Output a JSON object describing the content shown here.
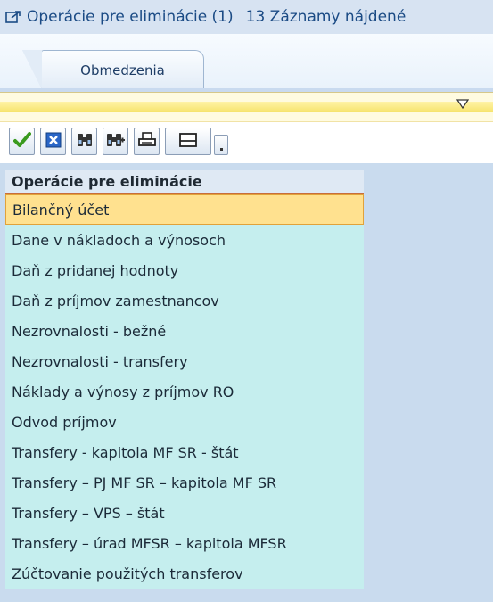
{
  "window": {
    "title": "Operácie pre eliminácie (1)",
    "record_count": "13 Záznamy nájdené"
  },
  "tabs": [
    {
      "label": "Obmedzenia"
    }
  ],
  "toolbar": {
    "icons": [
      "checkmark-icon",
      "cancel-icon",
      "find-icon",
      "find-next-icon",
      "print-icon",
      "more-dropdown-icon"
    ]
  },
  "list": {
    "header": "Operácie pre eliminácie",
    "items": [
      {
        "label": "Bilančný účet",
        "selected": true
      },
      {
        "label": "Dane v nákladoch a výnosoch"
      },
      {
        "label": "Daň z pridanej hodnoty"
      },
      {
        "label": "Daň z príjmov zamestnancov"
      },
      {
        "label": "Nezrovnalosti - bežné"
      },
      {
        "label": "Nezrovnalosti - transfery"
      },
      {
        "label": "Náklady a výnosy z príjmov RO"
      },
      {
        "label": "Odvod príjmov"
      },
      {
        "label": "Transfery - kapitola MF SR - štát"
      },
      {
        "label": "Transfery – PJ MF SR – kapitola MF SR"
      },
      {
        "label": "Transfery – VPS – štát"
      },
      {
        "label": "Transfery – úrad MFSR – kapitola MFSR"
      },
      {
        "label": "Zúčtovanie použitých transferov"
      }
    ]
  },
  "colors": {
    "title_text": "#1b4b85",
    "row_bg": "#c5eeee",
    "selected_bg": "#ffe18f",
    "header_underline": "#c86d3c"
  }
}
